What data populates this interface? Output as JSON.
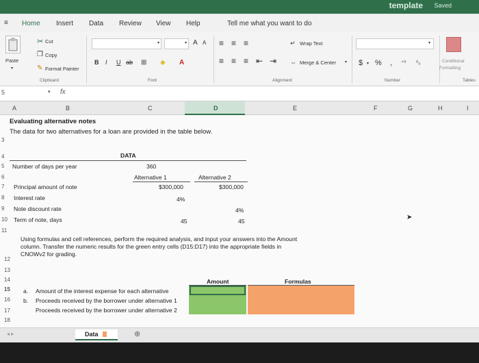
{
  "window": {
    "doc_title": "template",
    "status": "Saved"
  },
  "tabs": [
    "Home",
    "Insert",
    "Data",
    "Review",
    "View",
    "Help"
  ],
  "tell_me": "Tell me what you want to do",
  "ribbon": {
    "cut": "Cut",
    "copy": "Copy",
    "paste": "Paste",
    "format_painter": "Format Painter",
    "clipboard": "Clipboard",
    "font": "Font",
    "bold": "B",
    "italic": "I",
    "underline": "U",
    "wrap_text": "Wrap Text",
    "merge_center": "Merge & Center",
    "alignment": "Alignment",
    "number": "Number",
    "currency": "$",
    "percent": "%",
    "comma": ",",
    "conditional": "Conditional",
    "formatting": "Formatting",
    "tables": "Tables",
    "grow_font": "A",
    "shrink_font": "A"
  },
  "formula_bar": {
    "fx": "fx"
  },
  "columns": [
    "A",
    "B",
    "C",
    "D",
    "E",
    "F",
    "G",
    "H",
    "I"
  ],
  "rows": [
    "3",
    "4",
    "5",
    "6",
    "7",
    "8",
    "9",
    "10",
    "11",
    "12",
    "13",
    "14",
    "15",
    "16",
    "17",
    "18"
  ],
  "sheet": {
    "title": "Evaluating alternative notes",
    "subtitle": "The data for two alternatives for a loan are provided in the table below.",
    "data_header": "DATA",
    "days_label": "Number of days per year",
    "days_value": "360",
    "alt1": "Alternative 1",
    "alt2": "Alternative 2",
    "principal_label": "Principal amount of note",
    "principal_alt1": "$300,000",
    "principal_alt2": "$300,000",
    "interest_label": "Interest rate",
    "interest_alt1": "4%",
    "discount_label": "Note discount rate",
    "discount_alt2": "4%",
    "term_label": "Term of note, days",
    "term_alt1": "45",
    "term_alt2": "45",
    "instructions_line1": "Using formulas and cell references, perform the required analysis, and input your answers into the Amount",
    "instructions_line2": "column. Transfer the numeric results for the green entry cells (D15:D17) into the appropriate fields in",
    "instructions_line3": "CNOWv2 for grading.",
    "amount_header": "Amount",
    "formulas_header": "Formulas",
    "item_a": "a.",
    "item_a_text": "Amount of the interest expense for each alternative",
    "item_b": "b.",
    "item_b_text1": "Proceeds received by the borrower under alternative 1",
    "item_b_text2": "Proceeds received by the borrower under alternative 2"
  },
  "sheet_tab": "Data",
  "colors": {
    "entry_green": "#8cc66a",
    "formula_orange": "#f4a26a",
    "accent": "#2f6f4a"
  }
}
